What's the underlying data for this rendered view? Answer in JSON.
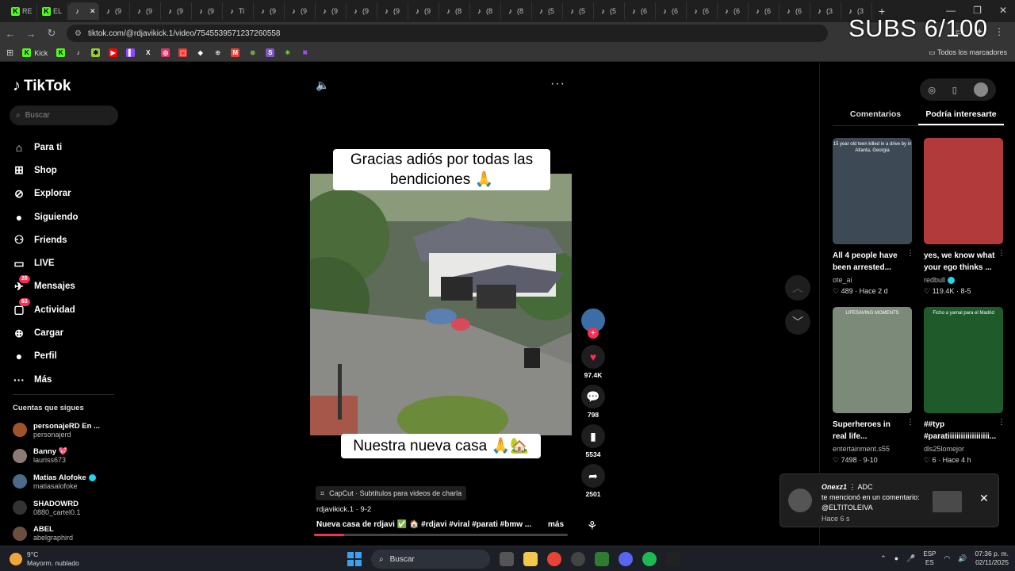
{
  "browser": {
    "tabs": [
      {
        "icon": "kick",
        "label": "RE"
      },
      {
        "icon": "kick",
        "label": "EL"
      },
      {
        "icon": "tiktok",
        "label": "",
        "active": true
      },
      {
        "icon": "tiktok",
        "label": "(9"
      },
      {
        "icon": "tiktok",
        "label": "(9"
      },
      {
        "icon": "tiktok",
        "label": "(9"
      },
      {
        "icon": "tiktok",
        "label": "(9"
      },
      {
        "icon": "tiktok",
        "label": "Ti"
      },
      {
        "icon": "tiktok",
        "label": "(9"
      },
      {
        "icon": "tiktok",
        "label": "(9"
      },
      {
        "icon": "tiktok",
        "label": "(9"
      },
      {
        "icon": "tiktok",
        "label": "(9"
      },
      {
        "icon": "tiktok",
        "label": "(9"
      },
      {
        "icon": "tiktok",
        "label": "(9"
      },
      {
        "icon": "tiktok",
        "label": "(8"
      },
      {
        "icon": "tiktok",
        "label": "(8"
      },
      {
        "icon": "tiktok",
        "label": "(8"
      },
      {
        "icon": "tiktok",
        "label": "(5"
      },
      {
        "icon": "tiktok",
        "label": "(5"
      },
      {
        "icon": "tiktok",
        "label": "(5"
      },
      {
        "icon": "tiktok",
        "label": "(6"
      },
      {
        "icon": "tiktok",
        "label": "(6"
      },
      {
        "icon": "tiktok",
        "label": "(6"
      },
      {
        "icon": "tiktok",
        "label": "(6"
      },
      {
        "icon": "tiktok",
        "label": "(6"
      },
      {
        "icon": "tiktok",
        "label": "(6"
      },
      {
        "icon": "tiktok",
        "label": "(3"
      },
      {
        "icon": "tiktok",
        "label": "(3"
      }
    ],
    "url": "tiktok.com/@rdjavikick.1/video/7545539571237260558",
    "all_bookmarks": "Todos los marcadores",
    "bookmark_kick": "Kick"
  },
  "overlay": {
    "subs": "SUBS 6/100"
  },
  "sidebar": {
    "logo": "TikTok",
    "search_placeholder": "Buscar",
    "nav": [
      {
        "label": "Para ti",
        "icon": "home-icon",
        "glyph": "⌂"
      },
      {
        "label": "Shop",
        "icon": "shop-icon",
        "glyph": "⊞"
      },
      {
        "label": "Explorar",
        "icon": "compass-icon",
        "glyph": "⊘"
      },
      {
        "label": "Siguiendo",
        "icon": "following-avatar-icon",
        "glyph": "●"
      },
      {
        "label": "Friends",
        "icon": "friends-icon",
        "glyph": "⚇"
      },
      {
        "label": "LIVE",
        "icon": "live-icon",
        "glyph": "▭"
      },
      {
        "label": "Mensajes",
        "icon": "messages-icon",
        "glyph": "✈",
        "badge": "26"
      },
      {
        "label": "Actividad",
        "icon": "activity-icon",
        "glyph": "▢",
        "badge": "83"
      },
      {
        "label": "Cargar",
        "icon": "upload-icon",
        "glyph": "⊕"
      },
      {
        "label": "Perfil",
        "icon": "profile-avatar-icon",
        "glyph": "●"
      },
      {
        "label": "Más",
        "icon": "more-dots-icon",
        "glyph": "···"
      }
    ],
    "following_title": "Cuentas que sigues",
    "following": [
      {
        "name": "personajeRD En ...",
        "user": "personajerd",
        "color": "#a0522d"
      },
      {
        "name": "Banny 💖",
        "user": "lauriss673",
        "color": "#8c7b75"
      },
      {
        "name": "Matias  Alofoke",
        "user": "matiasalofoke",
        "color": "#4a6b8a",
        "verified": true
      },
      {
        "name": "SHADOWRD",
        "user": "0880_cartel0.1",
        "color": "#333"
      },
      {
        "name": "ABEL",
        "user": "abelgraphird",
        "color": "#6b4e3d"
      }
    ]
  },
  "video": {
    "caption_top": "Gracias adiós por todas las bendiciones 🙏",
    "caption_bottom": "Nuestra nueva casa 🙏🏡",
    "capcut": "CapCut · Subtítulos para videos de charla",
    "author_line": "rdjavikick.1 · 9-2",
    "description": "Nueva casa de rdjavi ✅ 🏠 #rdjavi  #viral  #parati  #bmw  ...",
    "more": "más",
    "progress": 0.12
  },
  "actions": {
    "likes": "97.4K",
    "comments": "798",
    "saves": "5534",
    "shares": "2501"
  },
  "right_panel": {
    "tabs": [
      "Comentarios",
      "Podría interesarte"
    ],
    "active_tab": 1,
    "cards": [
      {
        "title": "All 4 people have been arrested...",
        "author": "ote_ai",
        "likes": "489",
        "time": "Hace 2 d",
        "thumb_text": "15 year old teen killed in a drive by in Atlanta, Georgia",
        "bg": "#3d4a55"
      },
      {
        "title": "yes, we know what your ego thinks ...",
        "author": "redbull",
        "verified": true,
        "likes": "119.4K",
        "time": "8-5",
        "thumb_text": "",
        "bg": "#b33a3a"
      },
      {
        "title": "Superheroes in real life...",
        "author": "entertainment.s55",
        "likes": "7498",
        "time": "9-10",
        "thumb_text": "LIFESAVING MOMENTS",
        "bg": "#7c8a7a"
      },
      {
        "title": "##typ #paratiiiiiiiiiiiiiiiiiii...",
        "author": "dls25lomejor",
        "likes": "6",
        "time": "Hace 4 h",
        "thumb_text": "Ficho a yamal para el Madrid",
        "bg": "#1f5a2a"
      }
    ]
  },
  "notification": {
    "name": "Onexz1",
    "tag": "ADC",
    "text": "te mencionó en un comentario: @ELTITOLEIVA",
    "time": "Hace 6 s"
  },
  "taskbar": {
    "temp": "9°C",
    "weather": "Mayorm. nublado",
    "search": "Buscar",
    "lang1": "ESP",
    "lang2": "ES",
    "time": "07:36 p. m.",
    "date": "02/11/2025"
  }
}
